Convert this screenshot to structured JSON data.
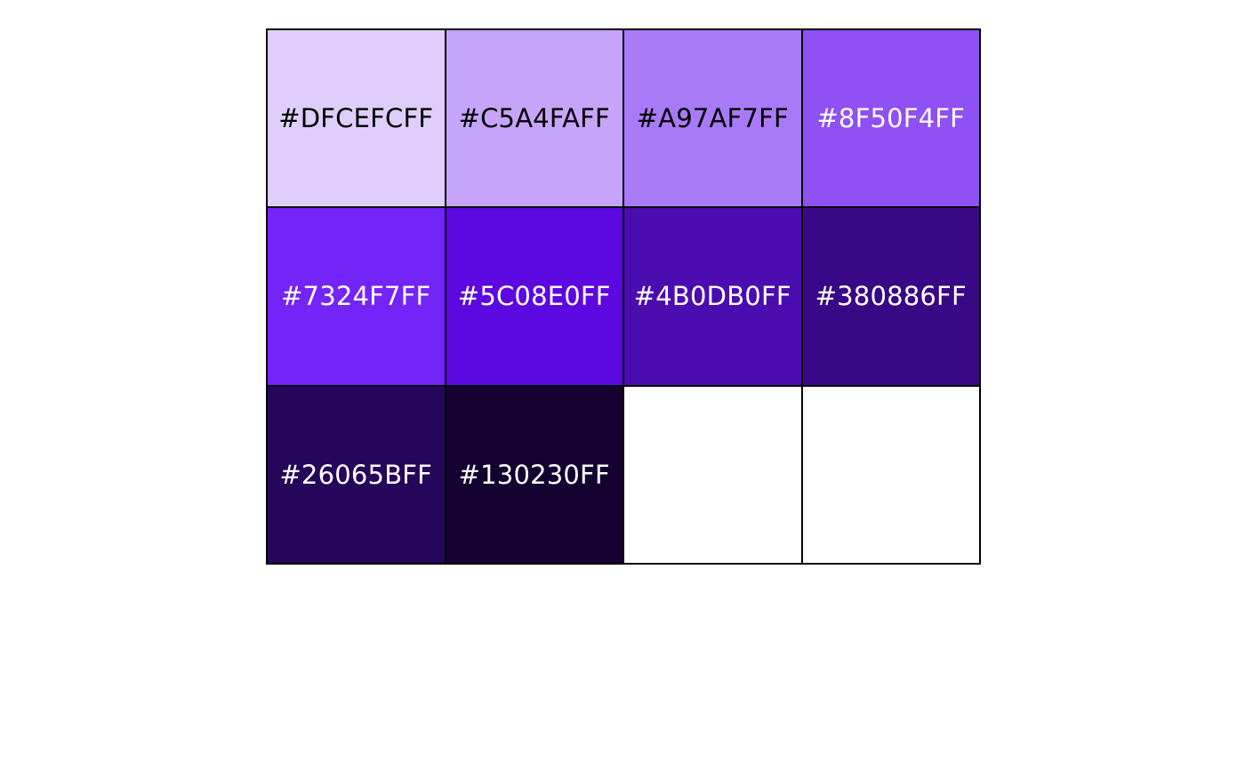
{
  "chart_data": {
    "type": "table",
    "columns": 4,
    "rows": 3,
    "swatches": [
      {
        "label": "#DFCEFCFF",
        "fill": "#DFCEFC",
        "text_color": "#000000"
      },
      {
        "label": "#C5A4FAFF",
        "fill": "#C5A4FA",
        "text_color": "#000000"
      },
      {
        "label": "#A97AF7FF",
        "fill": "#A97AF7",
        "text_color": "#000000"
      },
      {
        "label": "#8F50F4FF",
        "fill": "#8F50F4",
        "text_color": "#FFFFFF"
      },
      {
        "label": "#7324F7FF",
        "fill": "#7324F7",
        "text_color": "#FFFFFF"
      },
      {
        "label": "#5C08E0FF",
        "fill": "#5C08E0",
        "text_color": "#FFFFFF"
      },
      {
        "label": "#4B0DB0FF",
        "fill": "#4B0DB0",
        "text_color": "#FFFFFF"
      },
      {
        "label": "#380886FF",
        "fill": "#380886",
        "text_color": "#FFFFFF"
      },
      {
        "label": "#26065BFF",
        "fill": "#26065B",
        "text_color": "#FFFFFF"
      },
      {
        "label": "#130230FF",
        "fill": "#130230",
        "text_color": "#FFFFFF"
      },
      {
        "label": "",
        "fill": "#FFFFFF",
        "text_color": "#000000"
      },
      {
        "label": "",
        "fill": "#FFFFFF",
        "text_color": "#000000"
      }
    ],
    "border_color": "#000000",
    "background": "#FFFFFF"
  }
}
